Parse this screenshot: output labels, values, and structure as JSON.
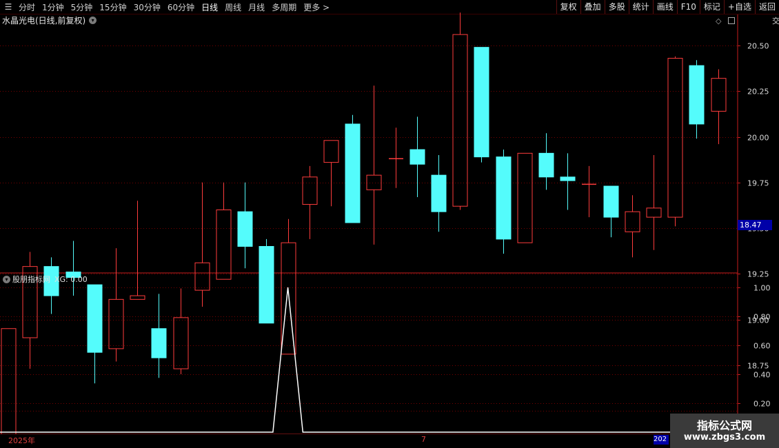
{
  "toolbar": {
    "periods": [
      "分时",
      "1分钟",
      "5分钟",
      "15分钟",
      "30分钟",
      "60分钟",
      "日线",
      "周线",
      "月线",
      "多周期",
      "更多"
    ],
    "more_arrow": ">",
    "tools": [
      "复权",
      "叠加",
      "多股",
      "统计",
      "画线",
      "F10",
      "标记",
      "+自选",
      "返回"
    ]
  },
  "chart_header": {
    "stock_name": "水晶光电(日线,前复权)",
    "dropdown_icon": "chevron-down-icon"
  },
  "indicator_header": {
    "name": "股朋指标网",
    "value_text": "XG: 0.00"
  },
  "current_price": "18.47",
  "right_strip_text": "交",
  "dates": {
    "start": "2025年",
    "mid": "7",
    "end_box": "202"
  },
  "watermark": {
    "title": "指标公式网",
    "url": "www.zbgs3.com"
  },
  "colors": {
    "up": "#ff3c3c",
    "down": "#54fcfc",
    "grid": "#7a0000",
    "border": "#c81e1e",
    "line": "#ffffff"
  },
  "chart_data": [
    {
      "type": "candlestick",
      "ylim": [
        18.0,
        20.75
      ],
      "yticks": [
        "20.50",
        "20.25",
        "20.00",
        "19.75",
        "19.50",
        "19.25",
        "19.00",
        "18.75"
      ],
      "candles": [
        {
          "o": 18.2,
          "c": 18.95,
          "h": 18.95,
          "l": 18.2
        },
        {
          "o": 18.9,
          "c": 19.29,
          "h": 19.37,
          "l": 18.73
        },
        {
          "o": 19.29,
          "c": 19.13,
          "h": 19.34,
          "l": 19.03
        },
        {
          "o": 19.26,
          "c": 19.23,
          "h": 19.43,
          "l": 19.13
        },
        {
          "o": 19.19,
          "c": 18.82,
          "h": 19.19,
          "l": 18.65
        },
        {
          "o": 18.84,
          "c": 19.11,
          "h": 19.39,
          "l": 18.77
        },
        {
          "o": 19.11,
          "c": 19.13,
          "h": 19.65,
          "l": 19.11
        },
        {
          "o": 18.95,
          "c": 18.79,
          "h": 19.14,
          "l": 18.68
        },
        {
          "o": 18.73,
          "c": 19.01,
          "h": 19.17,
          "l": 18.7
        },
        {
          "o": 19.16,
          "c": 19.31,
          "h": 19.75,
          "l": 19.07
        },
        {
          "o": 19.22,
          "c": 19.6,
          "h": 19.75,
          "l": 19.22
        },
        {
          "o": 19.59,
          "c": 19.4,
          "h": 19.75,
          "l": 19.28
        },
        {
          "o": 19.4,
          "c": 18.98,
          "h": 19.44,
          "l": 18.98
        },
        {
          "o": 18.81,
          "c": 19.42,
          "h": 19.55,
          "l": 18.81
        },
        {
          "o": 19.63,
          "c": 19.78,
          "h": 19.84,
          "l": 19.44
        },
        {
          "o": 19.86,
          "c": 19.98,
          "h": 19.98,
          "l": 19.62
        },
        {
          "o": 20.07,
          "c": 19.53,
          "h": 20.12,
          "l": 19.53
        },
        {
          "o": 19.71,
          "c": 19.79,
          "h": 20.28,
          "l": 19.41
        },
        {
          "o": 19.88,
          "c": 19.88,
          "h": 20.05,
          "l": 19.72
        },
        {
          "o": 19.93,
          "c": 19.85,
          "h": 20.11,
          "l": 19.67
        },
        {
          "o": 19.79,
          "c": 19.59,
          "h": 19.9,
          "l": 19.48
        },
        {
          "o": 19.62,
          "c": 20.56,
          "h": 20.68,
          "l": 19.6
        },
        {
          "o": 20.49,
          "c": 19.89,
          "h": 20.49,
          "l": 19.86
        },
        {
          "o": 19.89,
          "c": 19.44,
          "h": 19.93,
          "l": 19.36
        },
        {
          "o": 19.42,
          "c": 19.91,
          "h": 19.91,
          "l": 19.42
        },
        {
          "o": 19.91,
          "c": 19.78,
          "h": 20.02,
          "l": 19.71
        },
        {
          "o": 19.78,
          "c": 19.76,
          "h": 19.91,
          "l": 19.6
        },
        {
          "o": 19.74,
          "c": 19.74,
          "h": 19.84,
          "l": 19.56
        },
        {
          "o": 19.73,
          "c": 19.56,
          "h": 19.73,
          "l": 19.45
        },
        {
          "o": 19.48,
          "c": 19.59,
          "h": 19.68,
          "l": 19.34
        },
        {
          "o": 19.56,
          "c": 19.61,
          "h": 19.9,
          "l": 19.38
        },
        {
          "o": 19.56,
          "c": 20.43,
          "h": 20.44,
          "l": 19.51
        },
        {
          "o": 20.39,
          "c": 20.07,
          "h": 20.42,
          "l": 19.99
        },
        {
          "o": 20.14,
          "c": 20.32,
          "h": 20.37,
          "l": 19.96
        }
      ]
    },
    {
      "type": "line",
      "series": [
        {
          "name": "XG",
          "values": [
            0,
            0,
            0,
            0,
            0,
            0,
            0,
            0,
            0,
            0,
            0,
            0,
            0,
            1,
            0,
            0,
            0,
            0,
            0,
            0,
            0,
            0,
            0,
            0,
            0,
            0,
            0,
            0,
            0,
            0,
            0,
            0,
            0,
            0
          ]
        }
      ],
      "ylim": [
        0,
        1.1
      ],
      "yticks": [
        "1.00",
        "0.80",
        "0.60",
        "0.40",
        "0.20"
      ]
    }
  ]
}
